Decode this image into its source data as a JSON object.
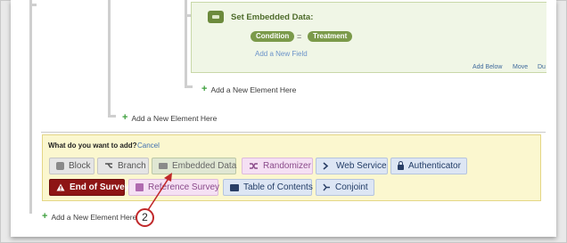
{
  "embedded_data": {
    "title": "Set Embedded Data:",
    "field_name": "Condition",
    "equals": "=",
    "field_value": "Treatment",
    "add_field_link": "Add a New Field",
    "actions": [
      "Add Below",
      "Move",
      "Du"
    ]
  },
  "add_links": {
    "inner": "Add a New Element Here",
    "middle": "Add a New Element Here",
    "outer": "Add a New Element Here"
  },
  "add_panel": {
    "prompt": "What do you want to add?",
    "cancel": "Cancel",
    "row1": [
      "Block",
      "Branch",
      "Embedded Data",
      "Randomizer",
      "Web Service",
      "Authenticator"
    ],
    "row2": [
      "End of Survey",
      "Reference Survey",
      "Table of Contents",
      "Conjoint"
    ]
  },
  "callout": {
    "number": "2",
    "color": "#c0282a"
  },
  "colors": {
    "accent_green": "#3ea03e",
    "end_of_survey": "#8e1515",
    "panel_yellow": "#fbf7cf"
  },
  "icons": {
    "add": "plus-icon",
    "embedded": "embedded-data-icon",
    "block": "cube-icon",
    "branch": "branch-icon",
    "randomizer": "shuffle-icon",
    "web_service": "web-service-icon",
    "authenticator": "lock-icon",
    "end_of_survey": "warning-icon",
    "reference_survey": "reference-icon",
    "table_of_contents": "table-of-contents-icon",
    "conjoint": "conjoint-icon"
  }
}
